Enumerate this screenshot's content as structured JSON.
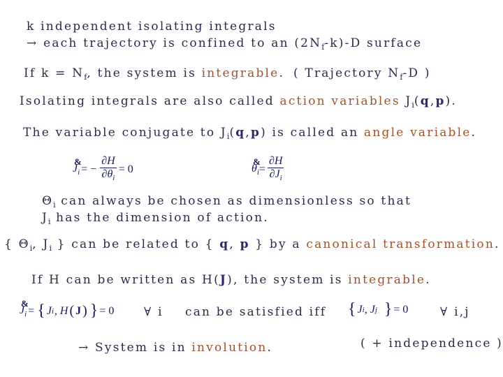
{
  "colors": {
    "text": "#2b2b4a",
    "highlight": "#a0522d",
    "math": "#1a1a5a"
  },
  "line1": {
    "text": "k independent isolating integrals"
  },
  "line2": {
    "arrow": "→",
    "text1": "each trajectory is confined to an (2N",
    "sub": "f",
    "text2": "-k)-D surface"
  },
  "line3": {
    "text1": "If k = N",
    "sub": "f",
    "text2": ", the system is ",
    "hl": "integrable",
    "text3": ".",
    "note1": "( Trajectory N",
    "note_sub": "f",
    "note2": "-D )"
  },
  "line4": {
    "text1": "Isolating integrals are also called ",
    "hl": "action variables",
    "text2": " J",
    "sub": "i",
    "text3": "(",
    "q": "q",
    "comma": ",",
    "p": "p",
    "text4": ")."
  },
  "line5": {
    "text1": "The variable conjugate to J",
    "sub": "i",
    "text2": "(",
    "q": "q",
    "comma": ",",
    "p": "p",
    "text3": ") is called an ",
    "hl": "angle variable",
    "text4": "."
  },
  "eq1": {
    "lhs": "J",
    "lhs_sub": "i",
    "eq": "= −",
    "num": "∂H",
    "den": "∂θ",
    "den_sub": "i",
    "rhs": "= 0"
  },
  "eq2": {
    "lhs": "θ",
    "lhs_sub": "i",
    "eq": "=",
    "num": "∂H",
    "den": "∂J",
    "den_sub": "i"
  },
  "line6": {
    "sym": "Θ",
    "sub": "i",
    "text": " can always be chosen as dimensionless so that"
  },
  "line7": {
    "sym": "J",
    "sub": "i",
    "text": " has the dimension of action."
  },
  "line8": {
    "open": "{ Θ",
    "sub1": "i",
    "mid": ", J",
    "sub2": "i",
    "text1": " } can be related to { ",
    "q": "q",
    "comma": ", ",
    "p": "p",
    "text2": " } by a ",
    "hl": "canonical transformation",
    "text3": "."
  },
  "line9": {
    "text1": "If H can be written as H(",
    "J": "J",
    "text2": "), the system is ",
    "hl": "integrable",
    "text3": "."
  },
  "eq3": {
    "lhs": "J",
    "lhs_sub": "i",
    "eq": "=",
    "inner": "J",
    "inner_sub": "i",
    "mid": ", H",
    "arg": "J",
    "rhs": "= 0"
  },
  "line10": {
    "forall": "∀ i",
    "text": "can be satisfied iff"
  },
  "eq4": {
    "a": "J",
    "a_sub": "i",
    "b": "J",
    "b_sub": "j",
    "rhs": "= 0"
  },
  "line11": {
    "forall": "∀ i,j"
  },
  "line12": {
    "arrow": "→",
    "text1": " System is in ",
    "hl": "involution",
    "text2": "."
  },
  "line13": {
    "text": "( + independence )"
  }
}
